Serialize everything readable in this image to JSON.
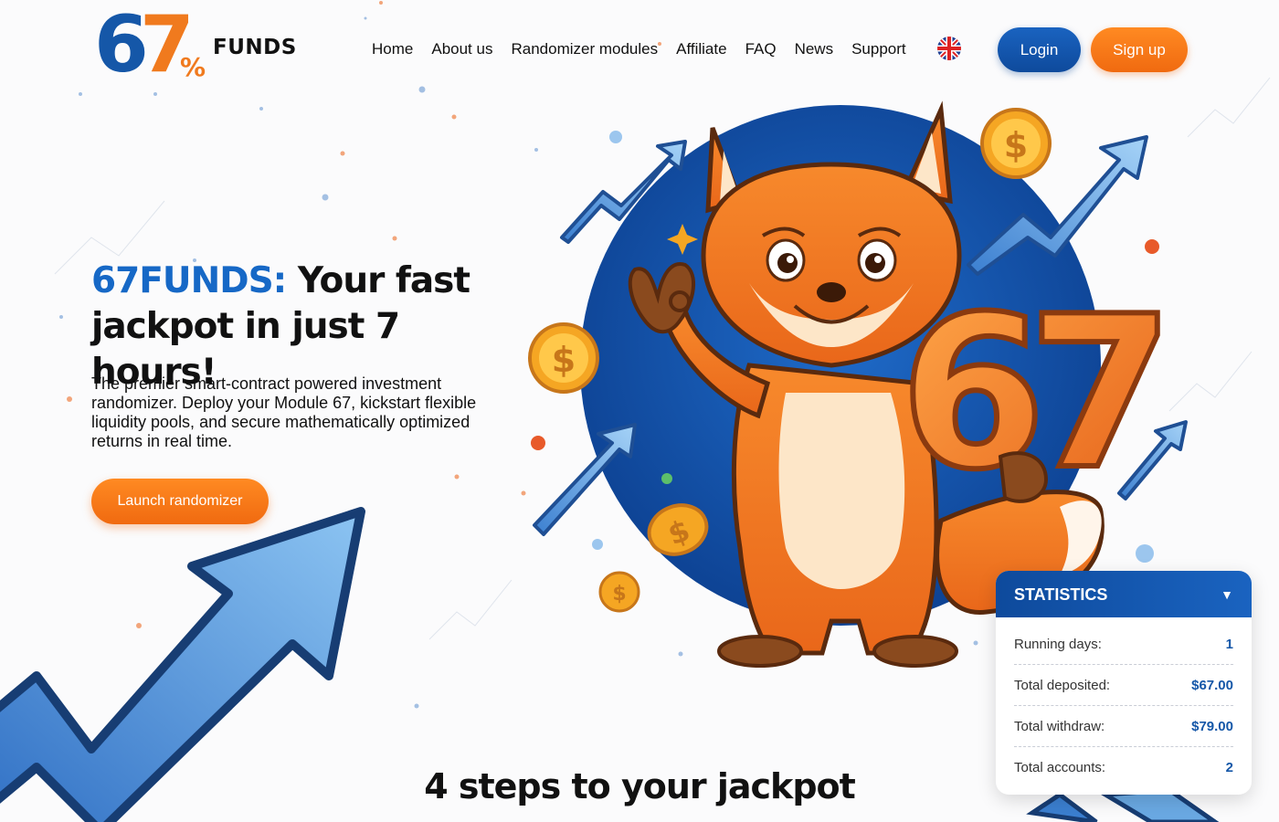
{
  "logo": {
    "digit1": "6",
    "digit2": "7",
    "percent": "%",
    "word": "FUNDS"
  },
  "nav": {
    "items": [
      {
        "label": "Home"
      },
      {
        "label": "About us"
      },
      {
        "label": "Randomizer modules"
      },
      {
        "label": "Affiliate"
      },
      {
        "label": "FAQ"
      },
      {
        "label": "News"
      },
      {
        "label": "Support"
      }
    ]
  },
  "language": {
    "icon": "uk-flag-icon"
  },
  "auth": {
    "login_label": "Login",
    "signup_label": "Sign up"
  },
  "hero": {
    "brand": "67FUNDS:",
    "title_rest": " Your fast jackpot in just 7 hours!",
    "description": "The premier smart-contract powered investment randomizer. Deploy your Module 67, kickstart flexible liquidity pools, and secure mathematically optimized returns in real time.",
    "cta_label": "Launch randomizer",
    "mascot_number": "67"
  },
  "statistics": {
    "title": "STATISTICS",
    "caret": "▼",
    "rows": [
      {
        "label": "Running days:",
        "value": "1"
      },
      {
        "label": "Total deposited:",
        "value": "$67.00"
      },
      {
        "label": "Total withdraw:",
        "value": "$79.00"
      },
      {
        "label": "Total accounts:",
        "value": "2"
      }
    ]
  },
  "steps": {
    "title": "4 steps to your jackpot"
  },
  "colors": {
    "brand_blue": "#1557a8",
    "brand_orange": "#f07a1e",
    "text": "#111111"
  }
}
